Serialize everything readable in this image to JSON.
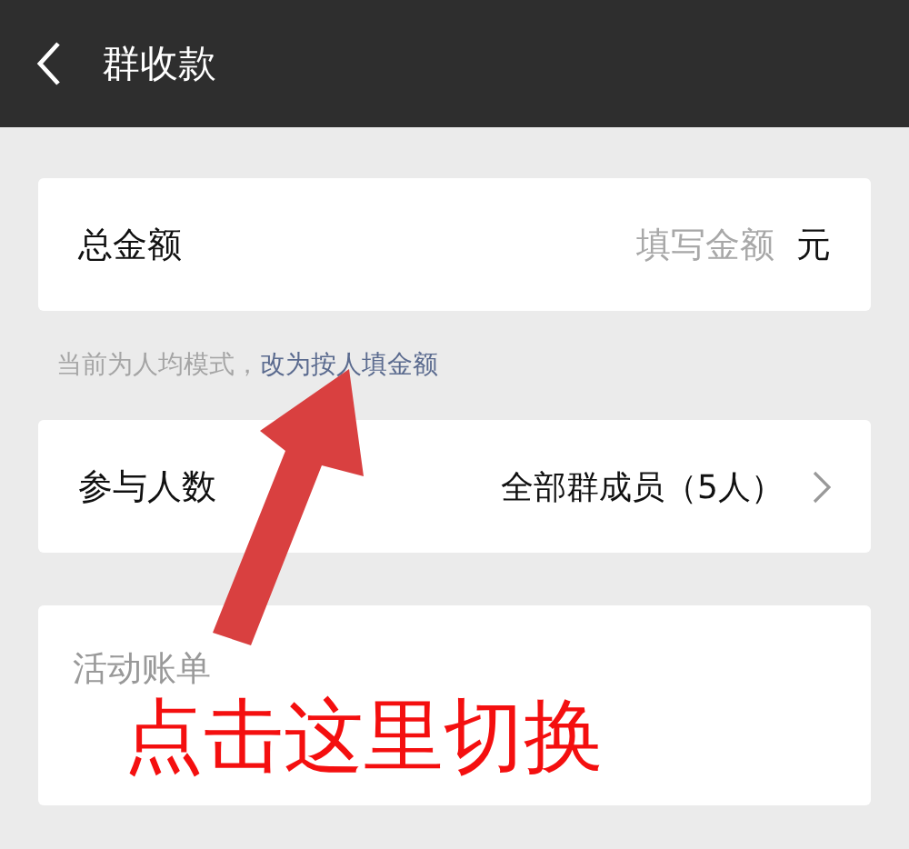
{
  "header": {
    "title": "群收款"
  },
  "amount": {
    "label": "总金额",
    "placeholder": "填写金额",
    "unit": "元"
  },
  "mode_hint": {
    "text": "当前为人均模式，",
    "link": "改为按人填金额"
  },
  "participants": {
    "label": "参与人数",
    "value": "全部群成员（5人）"
  },
  "note": {
    "placeholder": "活动账单"
  },
  "annotation": {
    "text": "点击这里切换"
  }
}
